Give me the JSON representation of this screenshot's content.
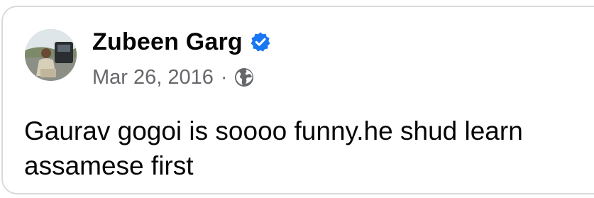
{
  "post": {
    "author_name": "Zubeen Garg",
    "verified": true,
    "date": "Mar 26, 2016",
    "separator": "·",
    "audience_icon": "globe-icon",
    "text_lines": [
      "Gaurav gogoi is soooo funny.he shud learn",
      "assamese first"
    ]
  },
  "colors": {
    "verified_badge": "#1877f2",
    "meta_text": "#65676b",
    "primary_text": "#050505",
    "card_border": "#d9dadc"
  }
}
